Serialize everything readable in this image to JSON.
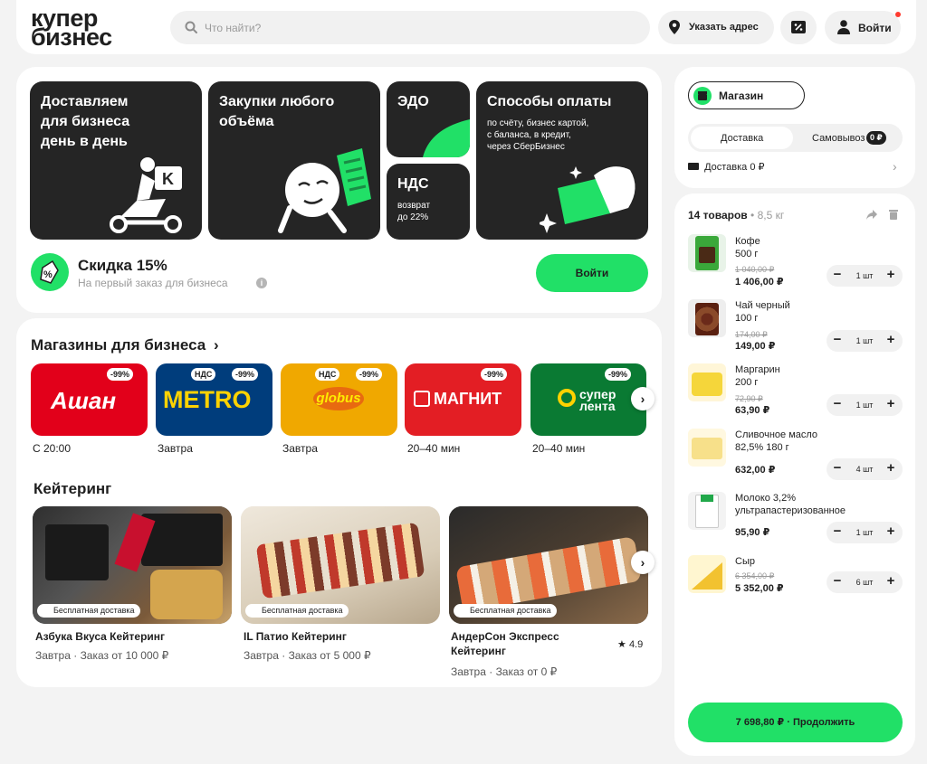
{
  "header": {
    "logo": [
      "купер",
      "бизнес"
    ],
    "search_placeholder": "Что найти?",
    "address_label": "Указать адрес",
    "login_label": "Войти"
  },
  "promo": {
    "tile1": [
      "Доставляем",
      "для бизнеса",
      "день в день"
    ],
    "tile2": [
      "Закупки любого",
      "объёма"
    ],
    "tile3": "ЭДО",
    "tile4": {
      "title": "НДС",
      "sub": [
        "возврат",
        "до 22%"
      ]
    },
    "tile5": {
      "title": "Способы оплаты",
      "sub": [
        "по счёту, бизнес картой,",
        "с баланса, в кредит,",
        "через СберБизнес"
      ]
    },
    "discount_title": "Скидка 15%",
    "discount_sub": "На первый заказ для бизнеса",
    "login_button": "Войти"
  },
  "stores": {
    "title": "Магазины для бизнеса",
    "nds": "НДС",
    "items": [
      {
        "logo": "Ашан",
        "badge": "-99%",
        "caption": "С 20:00",
        "color": "#e2001a"
      },
      {
        "logo": "METRO",
        "badge": "-99%",
        "caption": "Завтра",
        "color": "#003d7c"
      },
      {
        "logo": "globus",
        "badge": "-99%",
        "caption": "Завтра",
        "color": "#f0a800"
      },
      {
        "logo": "МАГНИТ",
        "badge": "-99%",
        "caption": "20–40 мин",
        "color": "#e31e24"
      },
      {
        "logo": [
          "супер",
          "лента"
        ],
        "badge": "-99%",
        "caption": "20–40 мин",
        "color": "#0a7a33"
      }
    ]
  },
  "catering": {
    "title": "Кейтеринг",
    "free_delivery": "Бесплатная доставка",
    "items": [
      {
        "name": "Азбука Вкуса Кейтеринг",
        "when": "Завтра",
        "order": "Заказ от 10 000 ₽"
      },
      {
        "name": "IL Патио Кейтеринг",
        "when": "Завтра",
        "order": "Заказ от 5 000 ₽"
      },
      {
        "name": [
          "АндерСон Экспресс",
          "Кейтеринг"
        ],
        "when": "Завтра",
        "order": "Заказ от 0 ₽",
        "rating": "4.9"
      }
    ]
  },
  "shop": {
    "label": "Магазин",
    "delivery_tab": "Доставка",
    "pickup_tab": "Самовывоз",
    "pickup_badge": "0 ₽",
    "delivery_cost": "Доставка 0 ₽"
  },
  "cart": {
    "count": "14 товаров",
    "weight": "8,5 кг",
    "items": [
      {
        "name": [
          "Кофе",
          "500 г"
        ],
        "old": "1 040,00 ₽",
        "price": "1 406,00 ₽",
        "qty": "1 шт"
      },
      {
        "name": [
          "Чай черный",
          "100 г"
        ],
        "old": "174,00 ₽",
        "price": "149,00 ₽",
        "qty": "1 шт"
      },
      {
        "name": [
          "Маргарин",
          "200 г"
        ],
        "old": "72,90 ₽",
        "price": "63,90 ₽",
        "qty": "1 шт"
      },
      {
        "name": [
          "Сливочное масло",
          "82,5% 180 г"
        ],
        "price": "632,00 ₽",
        "qty": "4 шт"
      },
      {
        "name": [
          "Молоко 3,2%",
          "ультрапастеризованное"
        ],
        "price": "95,90 ₽",
        "qty": "1 шт"
      },
      {
        "name": [
          "Сыр"
        ],
        "old": "6 354,00 ₽",
        "price": "5 352,00 ₽",
        "qty": "6 шт"
      }
    ],
    "checkout": "7 698,80 ₽ · Продолжить"
  },
  "colors": {
    "accent": "#21e067",
    "dark_tile": "#252525"
  },
  "icons": [
    "search-icon",
    "map-pin-icon",
    "percent-ticket-icon",
    "user-icon",
    "share-icon",
    "trash-icon",
    "chevron-right-icon",
    "star-icon",
    "truck-icon",
    "store-icon",
    "info-icon"
  ]
}
